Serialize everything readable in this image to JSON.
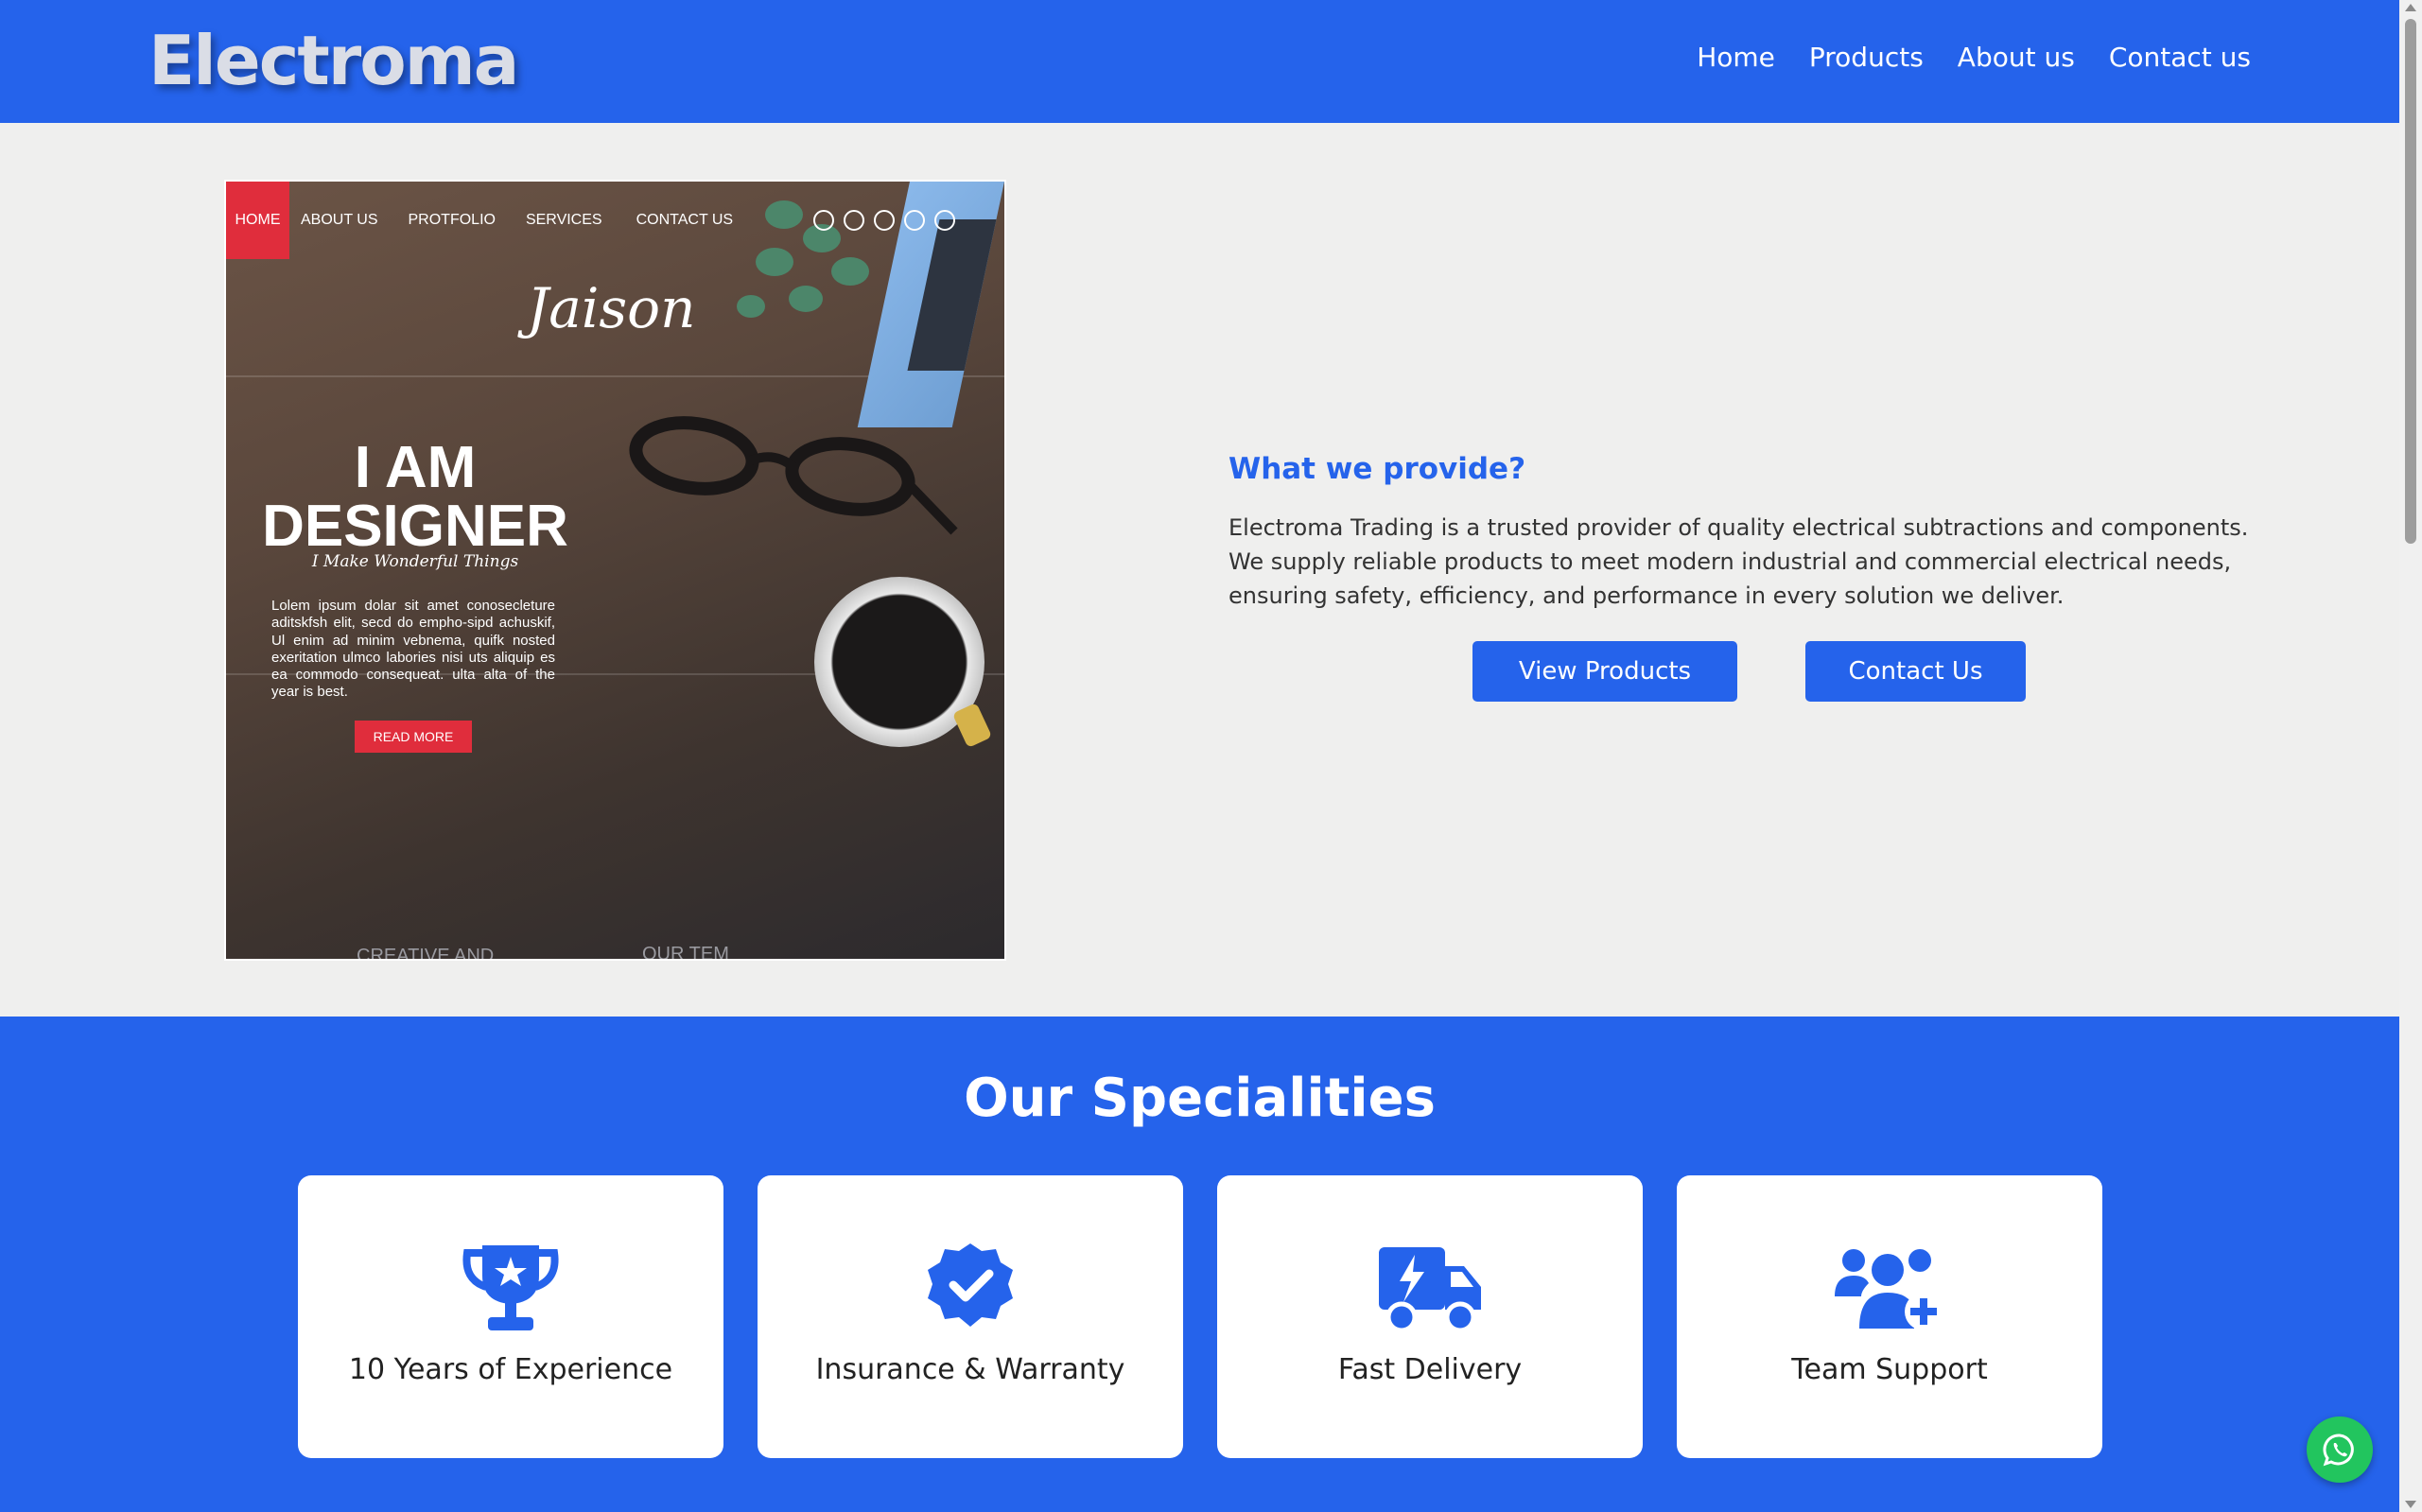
{
  "header": {
    "logo": "Electroma",
    "nav": [
      "Home",
      "Products",
      "About us",
      "Contact us"
    ]
  },
  "hero": {
    "mockup": {
      "nav": [
        "HOME",
        "ABOUT US",
        "PROTFOLIO",
        "SERVICES",
        "CONTACT US"
      ],
      "brand": "Jaison",
      "headline_line1": "I AM",
      "headline_line2": "DESIGNER",
      "tagline": "I Make Wonderful Things",
      "body": "Lolem ipsum dolar sit amet conosecleture aditskfsh elit, secd do empho-sipd achuskif, Ul enim ad minim vebnema, quifk nosted exeritation ulmco labories nisi uts aliquip es ea commodo consequeat. ulta alta of the year is best.",
      "button": "READ MORE",
      "footer_left": "CREATIVE AND",
      "footer_right": "OUR TEM"
    },
    "title": "What we provide?",
    "description": "Electroma Trading is a trusted provider of quality electrical subtractions and components. We supply reliable products to meet modern industrial and commercial electrical needs, ensuring safety, efficiency, and performance in every solution we deliver.",
    "buttons": {
      "view_products": "View Products",
      "contact_us": "Contact Us"
    }
  },
  "specialities": {
    "title": "Our Specialities",
    "items": [
      {
        "icon": "trophy-icon",
        "label": "10 Years of Experience"
      },
      {
        "icon": "verified-badge-icon",
        "label": "Insurance & Warranty"
      },
      {
        "icon": "delivery-truck-icon",
        "label": "Fast Delivery"
      },
      {
        "icon": "team-add-icon",
        "label": "Team Support"
      }
    ]
  },
  "colors": {
    "brand_blue": "#2563eb",
    "whatsapp_green": "#22c55e",
    "mock_red": "#e02d3c"
  }
}
